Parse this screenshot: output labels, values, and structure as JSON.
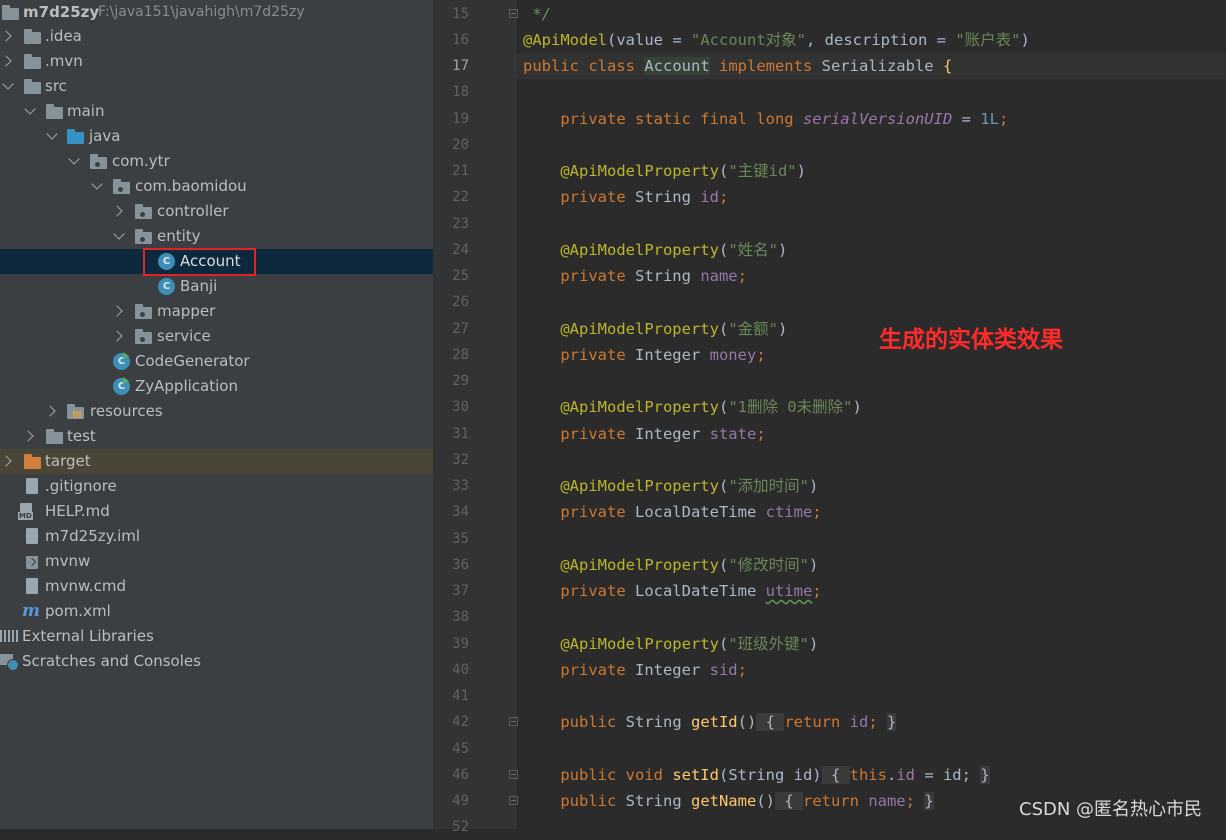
{
  "project": {
    "name": "m7d25zy",
    "path": "F:\\java151\\javahigh\\m7d25zy"
  },
  "tree": [
    {
      "label": ".idea"
    },
    {
      "label": ".mvn"
    },
    {
      "label": "src"
    },
    {
      "label": "main"
    },
    {
      "label": "java"
    },
    {
      "label": "com.ytr"
    },
    {
      "label": "com.baomidou"
    },
    {
      "label": "controller"
    },
    {
      "label": "entity"
    },
    {
      "label": "Account"
    },
    {
      "label": "Banji"
    },
    {
      "label": "mapper"
    },
    {
      "label": "service"
    },
    {
      "label": "CodeGenerator"
    },
    {
      "label": "ZyApplication"
    },
    {
      "label": "resources"
    },
    {
      "label": "test"
    },
    {
      "label": "target"
    },
    {
      "label": ".gitignore"
    },
    {
      "label": "HELP.md"
    },
    {
      "label": "m7d25zy.iml"
    },
    {
      "label": "mvnw"
    },
    {
      "label": "mvnw.cmd"
    },
    {
      "label": "pom.xml"
    },
    {
      "label": "External Libraries"
    },
    {
      "label": "Scratches and Consoles"
    }
  ],
  "icons": {
    "md_tag": "MD",
    "class_letter": "C",
    "maven_letter": "m"
  },
  "line_numbers": [
    "15",
    "16",
    "17",
    "18",
    "19",
    "20",
    "21",
    "22",
    "23",
    "24",
    "25",
    "26",
    "27",
    "28",
    "29",
    "30",
    "31",
    "32",
    "33",
    "34",
    "35",
    "36",
    "37",
    "38",
    "39",
    "40",
    "41",
    "42",
    "45",
    "46",
    "49",
    "52"
  ],
  "code": {
    "l15": " */",
    "l16_ann": "@ApiModel",
    "l16_p1": "(value = ",
    "l16_s1": "\"Account对象\"",
    "l16_p2": ", description = ",
    "l16_s2": "\"账户表\"",
    "l16_p3": ")",
    "l17_kw": "public class ",
    "l17_cls": "Account",
    "l17_impl": " implements ",
    "l17_ser": "Serializable ",
    "l17_brace": "{",
    "l19_kw": "    private static final long ",
    "l19_field": "serialVersionUID",
    "l19_eq": " = ",
    "l19_num": "1L",
    "l19_semi": ";",
    "fields": [
      {
        "ann": "    @ApiModelProperty",
        "str": "\"主键id\"",
        "kw": "    private ",
        "type": "String ",
        "name": "id"
      },
      {
        "ann": "    @ApiModelProperty",
        "str": "\"姓名\"",
        "kw": "    private ",
        "type": "String ",
        "name": "name"
      },
      {
        "ann": "    @ApiModelProperty",
        "str": "\"金额\"",
        "kw": "    private ",
        "type": "Integer ",
        "name": "money"
      },
      {
        "ann": "    @ApiModelProperty",
        "str": "\"1删除 0未删除\"",
        "kw": "    private ",
        "type": "Integer ",
        "name": "state"
      },
      {
        "ann": "    @ApiModelProperty",
        "str": "\"添加时间\"",
        "kw": "    private ",
        "type": "LocalDateTime ",
        "name": "ctime"
      },
      {
        "ann": "    @ApiModelProperty",
        "str": "\"修改时间\"",
        "kw": "    private ",
        "type": "LocalDateTime ",
        "name": "utime"
      },
      {
        "ann": "    @ApiModelProperty",
        "str": "\"班级外键\"",
        "kw": "    private ",
        "type": "Integer ",
        "name": "sid"
      }
    ],
    "open_paren": "(",
    "close_paren": ")",
    "semi": ";",
    "m42": {
      "kw": "    public ",
      "type": "String ",
      "name": "getId",
      "parens": "()",
      "ob": " { ",
      "ret": "return ",
      "val": "id",
      "semi": "; ",
      "cb": "}"
    },
    "m46": {
      "kw": "    public void ",
      "name": "setId",
      "params": "(String id)",
      "ob": " { ",
      "this": "this",
      "dot": ".",
      "field": "id",
      "rest": " = id; ",
      "cb": "}"
    },
    "m49": {
      "kw": "    public ",
      "type": "String ",
      "name": "getName",
      "parens": "()",
      "ob": " { ",
      "ret": "return ",
      "val": "name",
      "semi": "; ",
      "cb": "}"
    }
  },
  "caption": "生成的实体类效果",
  "watermark": "CSDN @匿名热心市民",
  "colors": {
    "tree_bg": "#3c3f41",
    "editor_bg": "#2b2b2b",
    "keyword": "#cc7832",
    "annotation": "#bbb529",
    "string": "#6a8759",
    "field": "#9876aa",
    "number": "#6897bb",
    "highlight_box": "#e0242b",
    "caption": "#ff2a2a"
  }
}
